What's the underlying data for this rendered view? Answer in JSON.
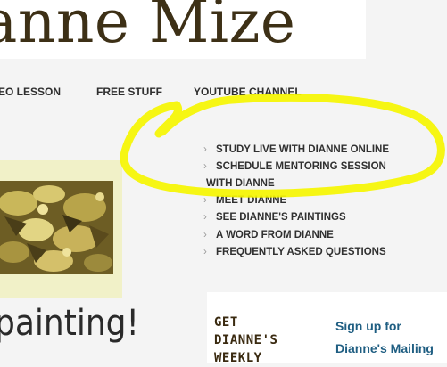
{
  "site": {
    "title": "anne Mize"
  },
  "nav": {
    "items": [
      {
        "label": "EO LESSON"
      },
      {
        "label": "FREE STUFF"
      },
      {
        "label": "YOUTUBE CHANNEL"
      }
    ]
  },
  "dropdown": {
    "items": [
      {
        "label": "STUDY LIVE WITH DIANNE ONLINE"
      },
      {
        "label": "SCHEDULE MENTORING SESSION"
      },
      {
        "label": "WITH DIANNE"
      },
      {
        "label": "MEET DIANNE"
      },
      {
        "label": "SEE DIANNE'S PAINTINGS"
      },
      {
        "label": "A WORD FROM DIANNE"
      },
      {
        "label": "FREQUENTLY ASKED QUESTIONS"
      }
    ],
    "chevron": "›"
  },
  "banner": {
    "text": "painting!"
  },
  "signup": {
    "weekly_lines": [
      "GET",
      "DIANNE'S",
      "WEEKLY"
    ],
    "mailing_lines": [
      "Sign up for",
      "Dianne's Mailing"
    ]
  },
  "colors": {
    "highlight": "#f5f500",
    "title": "#3d3016",
    "link_blue": "#1f5e82",
    "painting_band": "#f1f1c8"
  }
}
